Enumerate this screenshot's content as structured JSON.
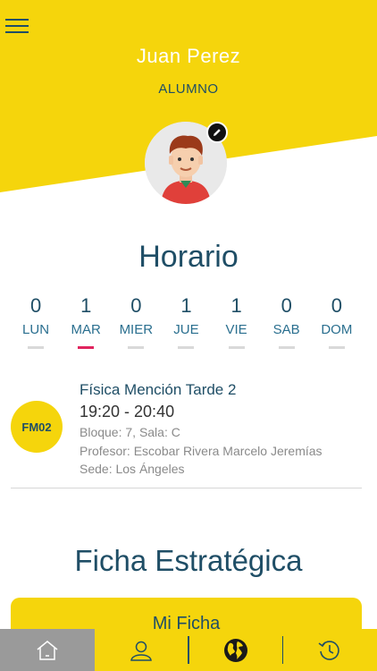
{
  "user": {
    "name": "Juan Perez",
    "role": "ALUMNO"
  },
  "schedule": {
    "title": "Horario",
    "days": [
      {
        "count": "0",
        "label": "LUN",
        "active": false
      },
      {
        "count": "1",
        "label": "MAR",
        "active": true
      },
      {
        "count": "0",
        "label": "MIER",
        "active": false
      },
      {
        "count": "1",
        "label": "JUE",
        "active": false
      },
      {
        "count": "1",
        "label": "VIE",
        "active": false
      },
      {
        "count": "0",
        "label": "SAB",
        "active": false
      },
      {
        "count": "0",
        "label": "DOM",
        "active": false
      }
    ]
  },
  "class_item": {
    "code": "FM02",
    "name": "Física Mención Tarde 2",
    "time": "19:20 - 20:40",
    "block": "Bloque:  7, Sala: C",
    "teacher": "Profesor:  Escobar Rivera Marcelo Jeremías",
    "campus": "Sede:  Los Ángeles"
  },
  "ficha": {
    "title": "Ficha Estratégica",
    "button_label": "Mi Ficha"
  },
  "bottom_nav": {
    "items": [
      {
        "icon": "home-icon",
        "active": true
      },
      {
        "icon": "user-icon",
        "active": false
      },
      {
        "icon": "globe-icon",
        "active": false
      },
      {
        "icon": "history-icon",
        "active": false
      }
    ]
  },
  "colors": {
    "brand_yellow": "#f5d50c",
    "primary_text": "#1f4e66",
    "active_day": "#e0245e",
    "nav_active": "#9a9a9a"
  }
}
